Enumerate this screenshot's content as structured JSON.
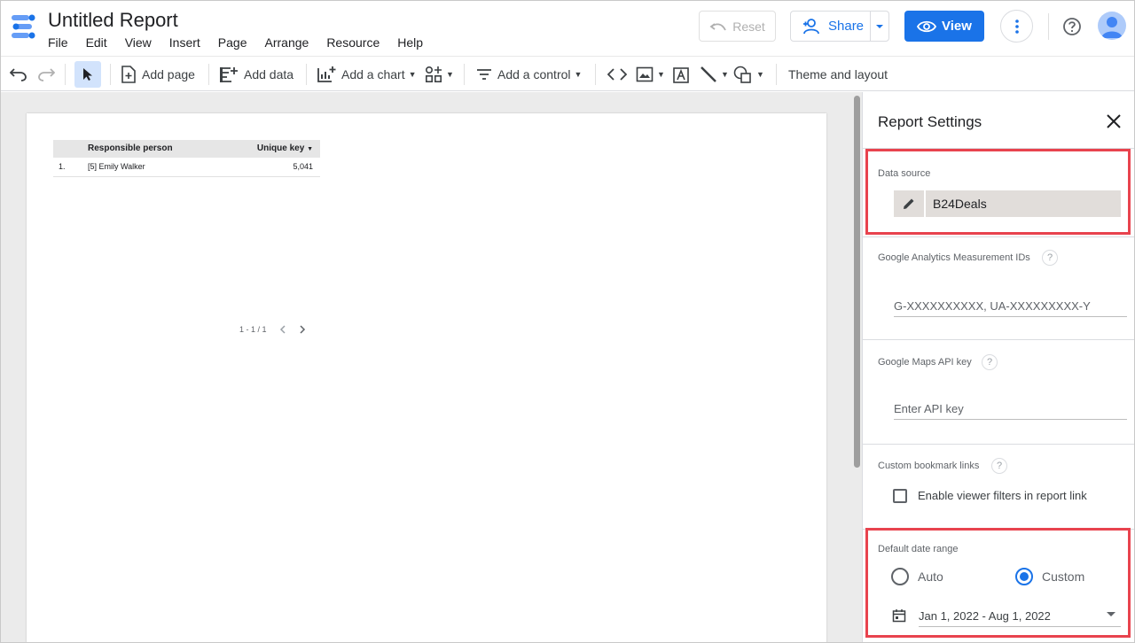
{
  "app": {
    "title": "Untitled Report",
    "menu": [
      "File",
      "Edit",
      "View",
      "Insert",
      "Page",
      "Arrange",
      "Resource",
      "Help"
    ],
    "reset_label": "Reset",
    "share_label": "Share",
    "view_label": "View"
  },
  "toolbar": {
    "add_page": "Add page",
    "add_data": "Add data",
    "add_chart": "Add a chart",
    "add_control": "Add a control",
    "theme_layout": "Theme and layout"
  },
  "report_table": {
    "headers": [
      "Responsible person",
      "Unique key"
    ],
    "rows": [
      {
        "index": "1.",
        "person": "[5] Emily Walker",
        "key": "5,041"
      }
    ],
    "pagination": "1 - 1 / 1"
  },
  "panel": {
    "title": "Report Settings",
    "data_source_label": "Data source",
    "data_source_name": "B24Deals",
    "ga_label": "Google Analytics Measurement IDs",
    "ga_placeholder": "G-XXXXXXXXXX, UA-XXXXXXXXX-Y",
    "maps_label": "Google Maps API key",
    "maps_placeholder": "Enter API key",
    "bookmark_label": "Custom bookmark links",
    "bookmark_checkbox": "Enable viewer filters in report link",
    "date_label": "Default date range",
    "radio_auto": "Auto",
    "radio_custom": "Custom",
    "date_value": "Jan 1, 2022 - Aug 1, 2022",
    "help_glyph": "?"
  },
  "colors": {
    "accent": "#1a73e8",
    "highlight": "#e8434e",
    "chip": "#e1ddda"
  }
}
